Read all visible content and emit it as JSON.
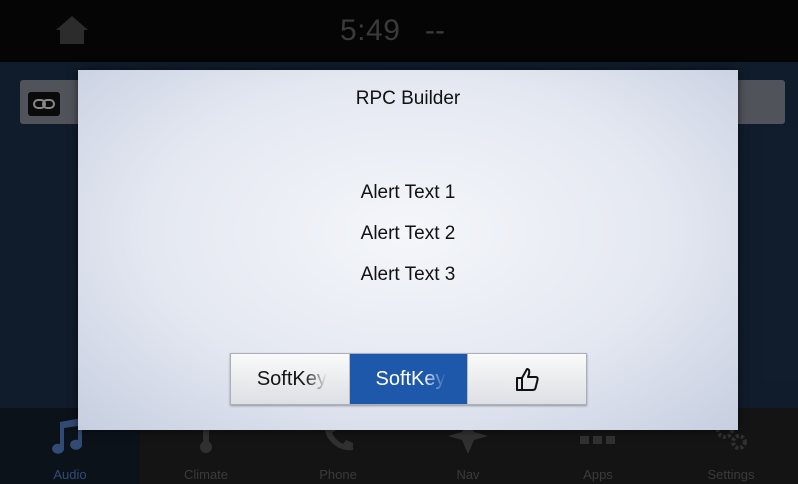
{
  "status": {
    "time": "5:49",
    "extra": "--",
    "home_icon": "home-icon"
  },
  "alert": {
    "title": "RPC Builder",
    "lines": [
      "Alert Text 1",
      "Alert Text 2",
      "Alert Text 3"
    ],
    "softkeys": [
      {
        "label": "SoftKey",
        "highlighted": false
      },
      {
        "label": "SoftKey",
        "highlighted": true
      },
      {
        "icon": "thumbs-up-icon",
        "highlighted": false
      }
    ],
    "highlight_color": "#1e58ab"
  },
  "nav": {
    "items": [
      {
        "label": "Audio",
        "icon": "music-note-icon",
        "active": true
      },
      {
        "label": "Climate",
        "icon": "thermometer-icon",
        "active": false
      },
      {
        "label": "Phone",
        "icon": "phone-icon",
        "active": false
      },
      {
        "label": "Nav",
        "icon": "navigation-arrow-icon",
        "active": false
      },
      {
        "label": "Apps",
        "icon": "apps-grid-icon",
        "active": false
      },
      {
        "label": "Settings",
        "icon": "gears-icon",
        "active": false
      }
    ],
    "active_color": "#4d74b3"
  }
}
